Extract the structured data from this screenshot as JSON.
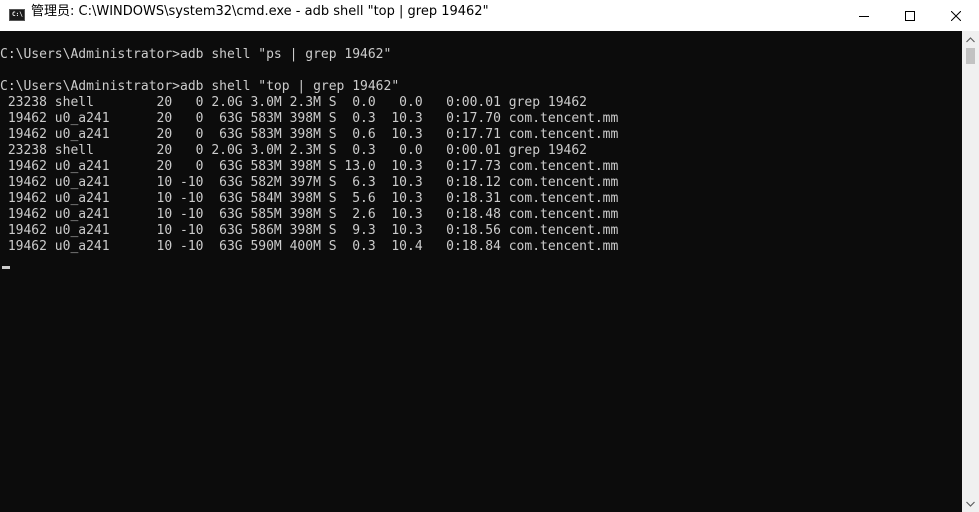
{
  "window": {
    "title": "管理员: C:\\WINDOWS\\system32\\cmd.exe - adb  shell \"top | grep 19462\"",
    "icon_label": "C:\\",
    "buttons": [
      "minimize-icon",
      "maximize-icon",
      "close-icon"
    ]
  },
  "console": {
    "commands": [
      "C:\\Users\\Administrator>adb shell \"ps | grep 19462\"",
      "C:\\Users\\Administrator>adb shell \"top | grep 19462\""
    ],
    "output": [
      " 23238 shell        20   0 2.0G 3.0M 2.3M S  0.0   0.0   0:00.01 grep 19462",
      " 19462 u0_a241      20   0  63G 583M 398M S  0.3  10.3   0:17.70 com.tencent.mm",
      " 19462 u0_a241      20   0  63G 583M 398M S  0.6  10.3   0:17.71 com.tencent.mm",
      " 23238 shell        20   0 2.0G 3.0M 2.3M S  0.3   0.0   0:00.01 grep 19462",
      " 19462 u0_a241      20   0  63G 583M 398M S 13.0  10.3   0:17.73 com.tencent.mm",
      " 19462 u0_a241      10 -10  63G 582M 397M S  6.3  10.3   0:18.12 com.tencent.mm",
      " 19462 u0_a241      10 -10  63G 584M 398M S  5.6  10.3   0:18.31 com.tencent.mm",
      " 19462 u0_a241      10 -10  63G 585M 398M S  2.6  10.3   0:18.48 com.tencent.mm",
      " 19462 u0_a241      10 -10  63G 586M 398M S  9.3  10.3   0:18.56 com.tencent.mm",
      " 19462 u0_a241      10 -10  63G 590M 400M S  0.3  10.4   0:18.84 com.tencent.mm"
    ]
  },
  "colors": {
    "background": "#0c0c0c",
    "text": "#cccccc",
    "titlebar": "#ffffff"
  }
}
